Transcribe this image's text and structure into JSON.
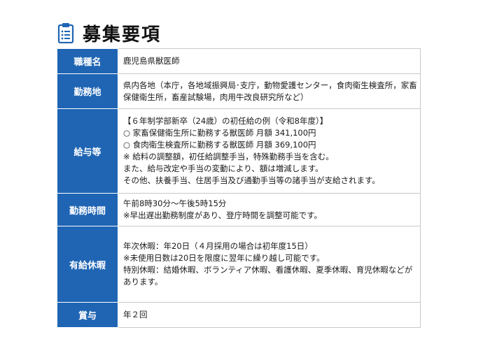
{
  "page": {
    "title": "募集要項",
    "accent_color": "#1f65b4",
    "title_icon": "clipboard-list-icon"
  },
  "rows": [
    {
      "label": "職種名",
      "lines": [
        "鹿児島県獣医師"
      ]
    },
    {
      "label": "勤務地",
      "lines": [
        "県内各地（本庁，各地域振興局･支庁，動物愛護センター，食肉衛生検査所，家畜保健衛生所，畜産試験場，肉用牛改良研究所など）"
      ]
    },
    {
      "label": "給与等",
      "lines": [
        "【６年制学部新卒（24歳）の初任給の例（令和8年度）】",
        "○ 家畜保健衛生所に勤務する獣医師 月額 341,100円",
        "○ 食肉衛生検査所に勤務する獣医師 月額 369,100円",
        "※ 給料の調整額，初任給調整手当，特殊勤務手当を含む。",
        "また、給与改定や手当の変動により、額は増減します。",
        "その他、扶養手当、住居手当及び通勤手当等の諸手当が支給されます。"
      ]
    },
    {
      "label": "勤務時間",
      "lines": [
        "午前8時30分～午後5時15分",
        "※早出遅出勤務制度があり、登庁時間を調整可能です。"
      ]
    },
    {
      "label": "有給休暇",
      "lines": [
        "年次休暇：年20日（４月採用の場合は初年度15日）",
        "※未使用日数は20日を限度に翌年に繰り越し可能です。",
        "特別休暇：結婚休暇、ボランティア休暇、看護休暇、夏季休暇、育児休暇などがあります。"
      ]
    },
    {
      "label": "賞与",
      "lines": [
        "年２回"
      ]
    }
  ]
}
